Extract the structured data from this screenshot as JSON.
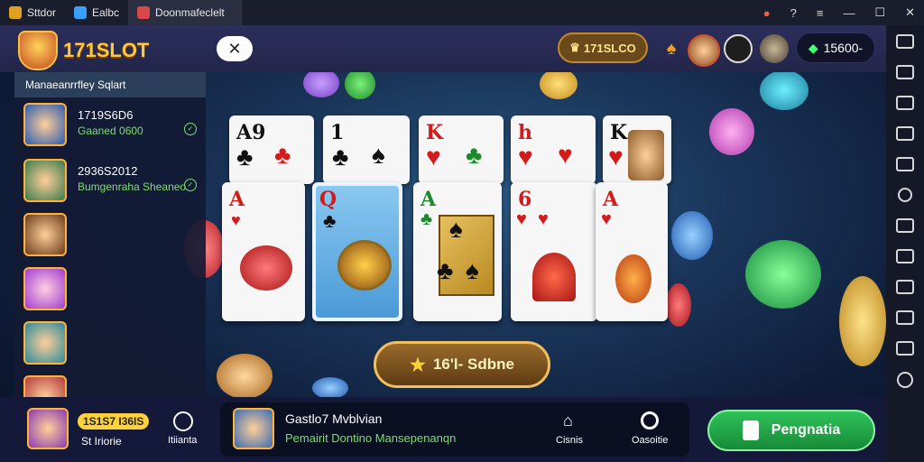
{
  "tabs": [
    {
      "label": "Sttdor",
      "color": "#e0a020"
    },
    {
      "label": "Ealbc",
      "color": "#3aa0ff"
    },
    {
      "label": "Doonmafeclelt",
      "color": "#d84848"
    }
  ],
  "header": {
    "logo_text": "171SLOT",
    "close_label": "✕",
    "brand_pill": "171SLCO",
    "balance": "15600-"
  },
  "sidebar": {
    "title": "Manaeanrrfley Sqlart",
    "players": [
      {
        "name": "1719S6D6",
        "status": "Gaaned 0600"
      },
      {
        "name": "2936S2012",
        "status": "Bumgenraha Sheaneo"
      },
      {
        "name": "",
        "status": ""
      },
      {
        "name": "",
        "status": ""
      },
      {
        "name": "",
        "status": ""
      }
    ]
  },
  "table": {
    "score_label": "16'l- Sdbne",
    "cards_top": [
      {
        "rank": "A9",
        "color": "black"
      },
      {
        "rank": "1",
        "color": "black"
      },
      {
        "rank": "K",
        "color": "red"
      },
      {
        "rank": "h",
        "color": "red"
      },
      {
        "rank": "K",
        "color": "black"
      }
    ],
    "cards_front": [
      {
        "rank": "A",
        "color": "red"
      },
      {
        "rank": "Q",
        "color": "red"
      },
      {
        "rank": "A",
        "color": "green"
      },
      {
        "rank": "6",
        "color": "red"
      },
      {
        "rank": "A",
        "color": "red"
      }
    ]
  },
  "bottom": {
    "user_tag": "1S1S7 I36IS",
    "user_sub": "St Iriorie",
    "mid_label": "Itiianta",
    "panel_title": "Gastlo7 Mvblvian",
    "panel_sub": "Pemairit Dontino Mansepenanqn",
    "nav1": "Cisnis",
    "nav2": "Oasoitie",
    "cta": "Pengnatia"
  },
  "colors": {
    "accent": "#ffc93a",
    "cta": "#2fc35a",
    "status": "#7be06a"
  }
}
